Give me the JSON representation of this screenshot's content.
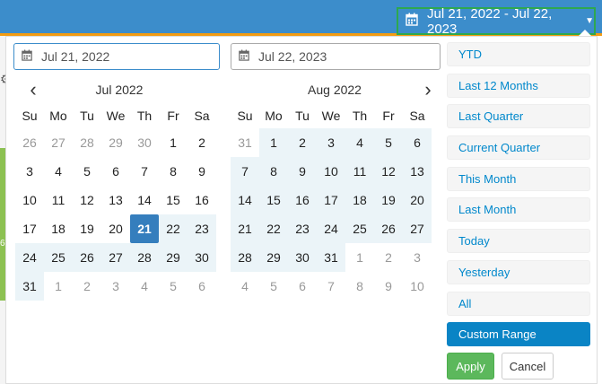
{
  "trigger": {
    "label": "Jul 21, 2022 - Jul 22, 2023",
    "icon": "calendar-icon"
  },
  "inputs": {
    "start": "Jul 21, 2022",
    "end": "Jul 22, 2023"
  },
  "weekdays": [
    "Su",
    "Mo",
    "Tu",
    "We",
    "Th",
    "Fr",
    "Sa"
  ],
  "left_calendar": {
    "title": "Jul 2022",
    "weeks": [
      [
        {
          "d": "26",
          "off": true
        },
        {
          "d": "27",
          "off": true
        },
        {
          "d": "28",
          "off": true
        },
        {
          "d": "29",
          "off": true
        },
        {
          "d": "30",
          "off": true
        },
        {
          "d": "1"
        },
        {
          "d": "2"
        }
      ],
      [
        {
          "d": "3"
        },
        {
          "d": "4"
        },
        {
          "d": "5"
        },
        {
          "d": "6"
        },
        {
          "d": "7"
        },
        {
          "d": "8"
        },
        {
          "d": "9"
        }
      ],
      [
        {
          "d": "10"
        },
        {
          "d": "11"
        },
        {
          "d": "12"
        },
        {
          "d": "13"
        },
        {
          "d": "14"
        },
        {
          "d": "15"
        },
        {
          "d": "16"
        }
      ],
      [
        {
          "d": "17"
        },
        {
          "d": "18"
        },
        {
          "d": "19"
        },
        {
          "d": "20"
        },
        {
          "d": "21",
          "sel": true
        },
        {
          "d": "22",
          "range": true
        },
        {
          "d": "23",
          "range": true
        }
      ],
      [
        {
          "d": "24",
          "range": true
        },
        {
          "d": "25",
          "range": true
        },
        {
          "d": "26",
          "range": true
        },
        {
          "d": "27",
          "range": true
        },
        {
          "d": "28",
          "range": true
        },
        {
          "d": "29",
          "range": true
        },
        {
          "d": "30",
          "range": true
        }
      ],
      [
        {
          "d": "31",
          "range": true
        },
        {
          "d": "1",
          "off": true
        },
        {
          "d": "2",
          "off": true
        },
        {
          "d": "3",
          "off": true
        },
        {
          "d": "4",
          "off": true
        },
        {
          "d": "5",
          "off": true
        },
        {
          "d": "6",
          "off": true
        }
      ]
    ]
  },
  "right_calendar": {
    "title": "Aug 2022",
    "weeks": [
      [
        {
          "d": "31",
          "off": true
        },
        {
          "d": "1",
          "range": true
        },
        {
          "d": "2",
          "range": true
        },
        {
          "d": "3",
          "range": true
        },
        {
          "d": "4",
          "range": true
        },
        {
          "d": "5",
          "range": true
        },
        {
          "d": "6",
          "range": true
        }
      ],
      [
        {
          "d": "7",
          "range": true
        },
        {
          "d": "8",
          "range": true
        },
        {
          "d": "9",
          "range": true
        },
        {
          "d": "10",
          "range": true
        },
        {
          "d": "11",
          "range": true
        },
        {
          "d": "12",
          "range": true
        },
        {
          "d": "13",
          "range": true
        }
      ],
      [
        {
          "d": "14",
          "range": true
        },
        {
          "d": "15",
          "range": true
        },
        {
          "d": "16",
          "range": true
        },
        {
          "d": "17",
          "range": true
        },
        {
          "d": "18",
          "range": true
        },
        {
          "d": "19",
          "range": true
        },
        {
          "d": "20",
          "range": true
        }
      ],
      [
        {
          "d": "21",
          "range": true
        },
        {
          "d": "22",
          "range": true
        },
        {
          "d": "23",
          "range": true
        },
        {
          "d": "24",
          "range": true
        },
        {
          "d": "25",
          "range": true
        },
        {
          "d": "26",
          "range": true
        },
        {
          "d": "27",
          "range": true
        }
      ],
      [
        {
          "d": "28",
          "range": true
        },
        {
          "d": "29",
          "range": true
        },
        {
          "d": "30",
          "range": true
        },
        {
          "d": "31",
          "range": true
        },
        {
          "d": "1",
          "off": true
        },
        {
          "d": "2",
          "off": true
        },
        {
          "d": "3",
          "off": true
        }
      ],
      [
        {
          "d": "4",
          "off": true
        },
        {
          "d": "5",
          "off": true
        },
        {
          "d": "6",
          "off": true
        },
        {
          "d": "7",
          "off": true
        },
        {
          "d": "8",
          "off": true
        },
        {
          "d": "9",
          "off": true
        },
        {
          "d": "10",
          "off": true
        }
      ]
    ]
  },
  "ranges": [
    {
      "label": "YTD"
    },
    {
      "label": "Last 12 Months"
    },
    {
      "label": "Last Quarter"
    },
    {
      "label": "Current Quarter"
    },
    {
      "label": "This Month"
    },
    {
      "label": "Last Month"
    },
    {
      "label": "Today"
    },
    {
      "label": "Yesterday"
    },
    {
      "label": "All"
    },
    {
      "label": "Custom Range",
      "active": true
    }
  ],
  "buttons": {
    "apply": "Apply",
    "cancel": "Cancel"
  },
  "background": {
    "digit": "6"
  },
  "colors": {
    "accent": "#357ebd",
    "range": "#ebf4f8",
    "apply": "#5cb85c",
    "topbar": "#3c8dcb"
  }
}
